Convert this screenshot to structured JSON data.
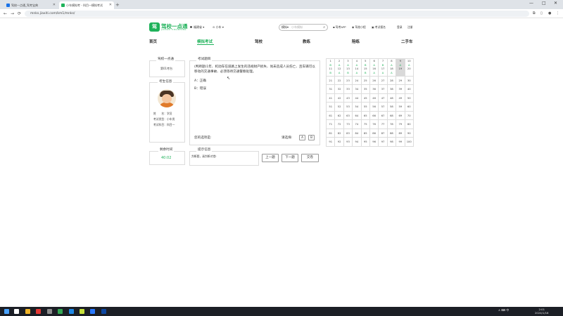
{
  "browser": {
    "tabs": [
      {
        "title": "驾校一点通_驾考宝典",
        "active": false
      },
      {
        "title": "小车模拟考 - 科目一模拟考试",
        "active": true
      }
    ],
    "new_tab": "+",
    "url": "mnks.jiaxiti.com/km1/mnks/",
    "window_controls": {
      "minimize": "—",
      "maximize": "□",
      "close": "✕"
    },
    "nav": {
      "back": "←",
      "forward": "→",
      "reload": "⟳",
      "home": "⌂"
    }
  },
  "header": {
    "logo_mark": "驾",
    "logo_text": "驾校一点通",
    "logo_sub": "JIAXIAO YIDIANTONG",
    "city": "福建省",
    "vehicle": "小车",
    "search_prefix": "模拟",
    "search_placeholder": "小车模拟",
    "links": [
      "驾考APP",
      "驾校小程",
      "考试报名",
      "登录",
      "注册"
    ]
  },
  "nav": {
    "items": [
      "首页",
      "模拟考试",
      "驾校",
      "教练",
      "陪练",
      "二手车"
    ],
    "active_index": 1
  },
  "left": {
    "room_legend": "驾校一点通",
    "room_name": "第01考台",
    "candidate_legend": "考生信息",
    "name_label": "姓　　名：",
    "name_value": "学员",
    "type_label": "考试类型：",
    "type_value": "小车类",
    "subject_label": "考试科目：",
    "subject_value": "科目一",
    "time_legend": "剩余时间",
    "time_value": "40:02"
  },
  "question": {
    "legend": "考试题目",
    "text": "(判断题)1年、机动车在道路上发生的违规财产损失、尚未造成人员伤亡、且车辆可以移动的交通事故、必须等待交通警察处理。",
    "options": [
      "A：正确",
      "B：错误"
    ],
    "answer_label": "您的选项是:",
    "select_label": "请选择:",
    "option_buttons": [
      "A",
      "B"
    ]
  },
  "hint": {
    "legend": "提示信息",
    "text": "判断题，请判断对错!"
  },
  "actions": {
    "prev": "上一题",
    "next": "下一题",
    "submit": "交卷"
  },
  "answer_grid": {
    "head": [
      [
        "1",
        "2",
        "3",
        "4",
        "5",
        "6",
        "7",
        "8",
        "9",
        "10"
      ],
      [
        "B",
        "A",
        "A",
        "A",
        "B",
        "A",
        "B",
        "A",
        "A",
        "A"
      ],
      [
        "11",
        "12",
        "13",
        "14",
        "15",
        "16",
        "17",
        "18",
        "19",
        "20"
      ],
      [
        "B",
        "A",
        "B",
        "A",
        "B",
        "A",
        "A",
        "A",
        "",
        ""
      ]
    ],
    "rows": [
      [
        "21",
        "22",
        "23",
        "24",
        "25",
        "26",
        "27",
        "28",
        "29",
        "30"
      ],
      [
        "31",
        "32",
        "33",
        "34",
        "35",
        "36",
        "37",
        "38",
        "39",
        "40"
      ],
      [
        "41",
        "42",
        "43",
        "44",
        "45",
        "46",
        "47",
        "48",
        "49",
        "50"
      ],
      [
        "51",
        "52",
        "53",
        "54",
        "55",
        "56",
        "57",
        "58",
        "59",
        "60"
      ],
      [
        "61",
        "62",
        "63",
        "64",
        "65",
        "66",
        "67",
        "68",
        "69",
        "70"
      ],
      [
        "71",
        "72",
        "73",
        "74",
        "75",
        "76",
        "77",
        "78",
        "79",
        "80"
      ],
      [
        "81",
        "82",
        "83",
        "84",
        "85",
        "86",
        "87",
        "88",
        "89",
        "90"
      ],
      [
        "91",
        "92",
        "93",
        "94",
        "95",
        "96",
        "97",
        "98",
        "99",
        "100"
      ]
    ],
    "current": 19
  },
  "taskbar": {
    "tray": "∧ ⌨ 中",
    "time": "2:01",
    "date": "2024/1/16"
  }
}
